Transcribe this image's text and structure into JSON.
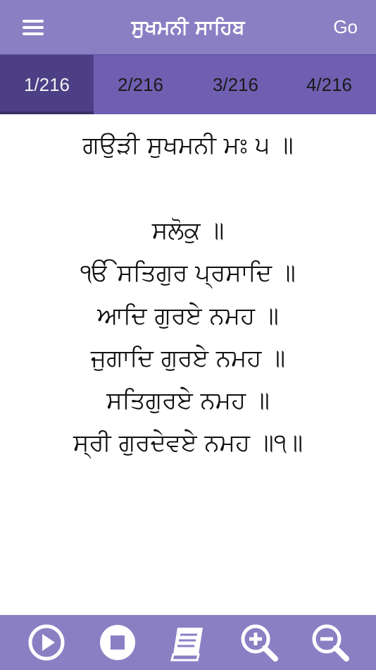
{
  "header": {
    "title": "ਸੁਖਮਨੀ ਸਾਹਿਬ",
    "go_label": "Go"
  },
  "tabs": [
    {
      "label": "1/216",
      "active": true
    },
    {
      "label": "2/216",
      "active": false
    },
    {
      "label": "3/216",
      "active": false
    },
    {
      "label": "4/216",
      "active": false
    }
  ],
  "content": {
    "lines": [
      "ਗਉੜੀ ਸੁਖਮਨੀ ਮਃ ੫ ॥",
      "ਸਲੋਕੁ ॥",
      "ੴ ਸਤਿਗੁਰ ਪ੍ਰਸਾਦਿ ॥",
      "ਆਦਿ ਗੁਰਏ ਨਮਹ ॥",
      "ਜੁਗਾਦਿ ਗੁਰਏ ਨਮਹ ॥",
      "ਸਤਿਗੁਰਏ ਨਮਹ ॥",
      "ਸ੍ਰੀ ਗੁਰਦੇਵਏ ਨਮਹ ॥੧॥"
    ]
  },
  "footer": {
    "icons": [
      "play-icon",
      "stop-icon",
      "book-icon",
      "zoom-in-icon",
      "zoom-out-icon"
    ]
  },
  "colors": {
    "header": "#8b7fc4",
    "tab_bar": "#6f5fb1",
    "tab_active": "#4c3f86",
    "footer": "#8b7fc4"
  }
}
